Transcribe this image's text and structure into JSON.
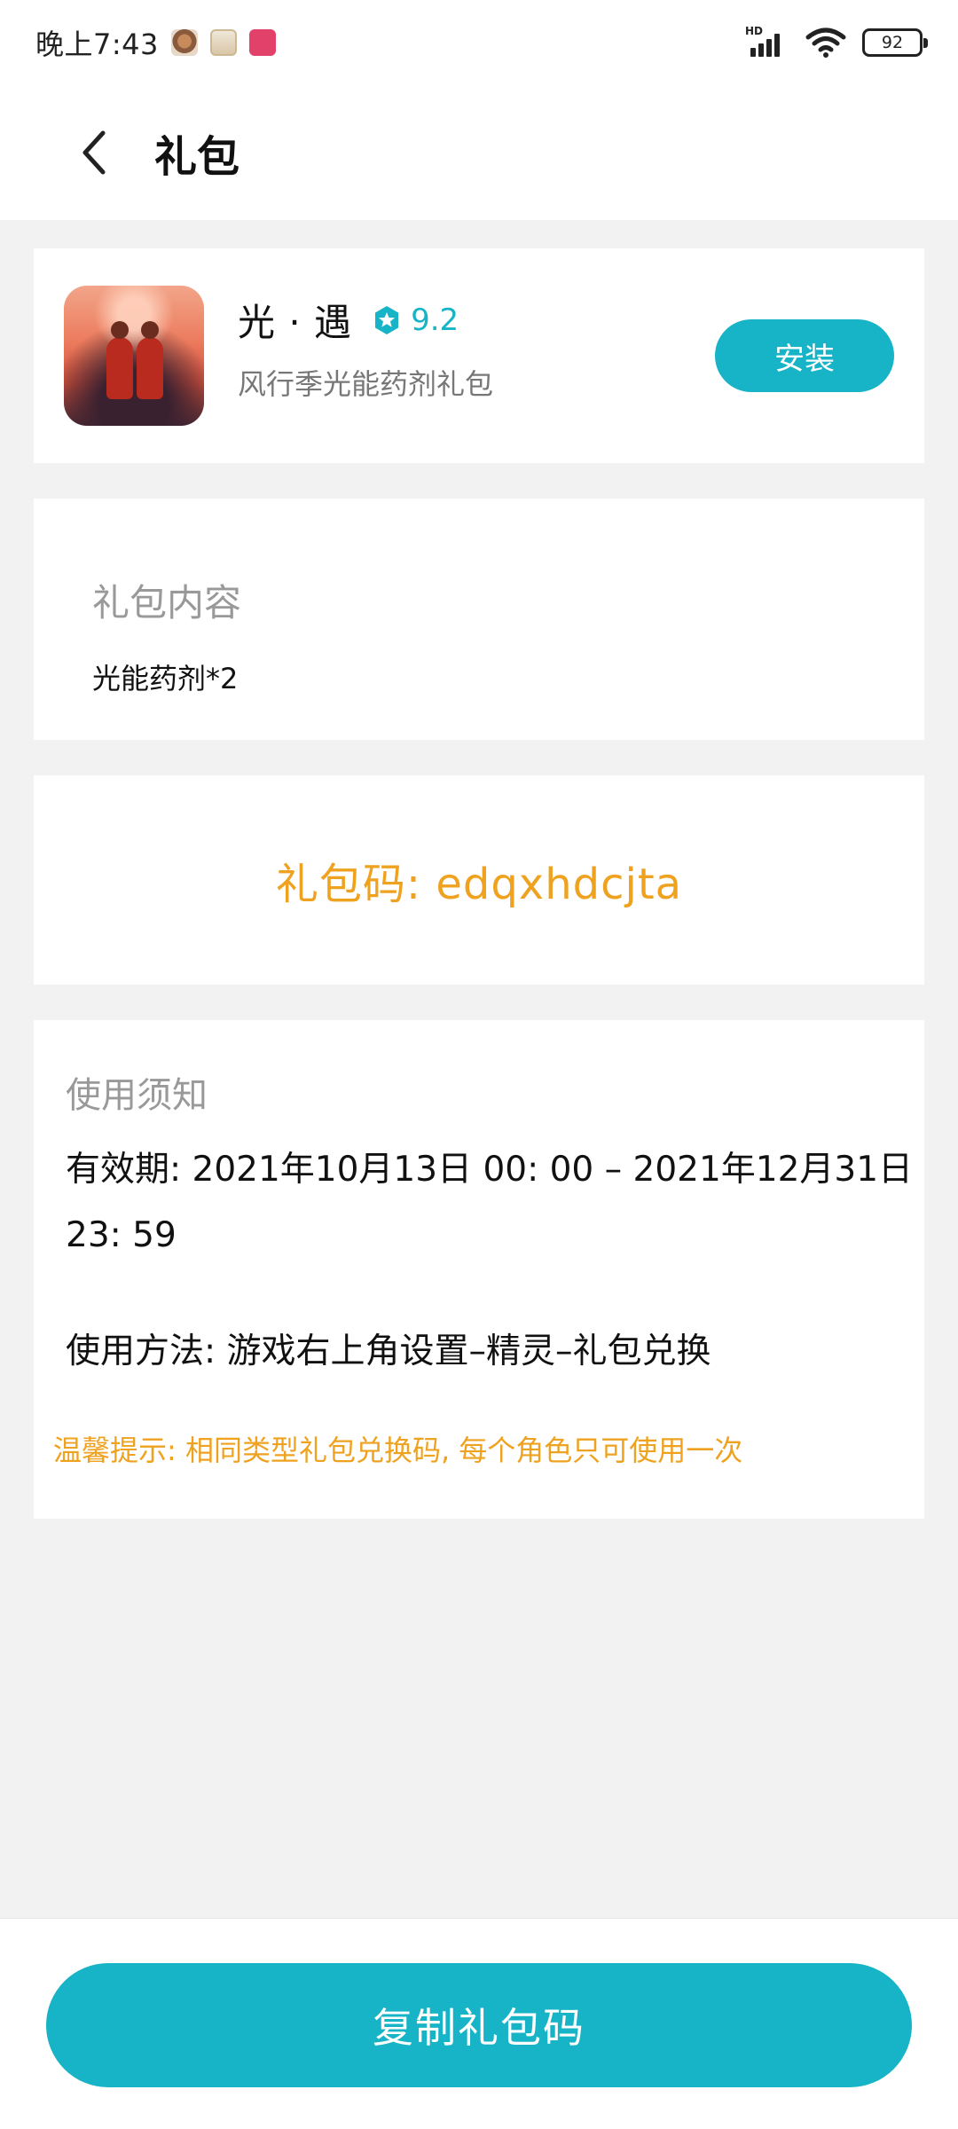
{
  "status_bar": {
    "time": "晚上7:43",
    "notification_icons": [
      "app-notification-icon",
      "app-notification-icon",
      "app-notification-icon"
    ],
    "signal_label": "HD",
    "battery_level": "92"
  },
  "header": {
    "title": "礼包"
  },
  "game": {
    "name": "光 · 遇",
    "rating": "9.2",
    "subtitle": "风行季光能药剂礼包",
    "install_label": "安装"
  },
  "gift_content": {
    "title": "礼包内容",
    "body": "光能药剂*2"
  },
  "gift_code": {
    "text": "礼包码: edqxhdcjta"
  },
  "notice": {
    "title": "使用须知",
    "validity": "有效期: 2021年10月13日 00: 00 – 2021年12月31日 23: 59",
    "usage": "使用方法: 游戏右上角设置–精灵–礼包兑换",
    "tip": "温馨提示: 相同类型礼包兑换码, 每个角色只可使用一次"
  },
  "bottom": {
    "copy_label": "复制礼包码"
  },
  "colors": {
    "accent": "#17b3c6",
    "highlight": "#efa21f",
    "background": "#f2f2f2"
  }
}
